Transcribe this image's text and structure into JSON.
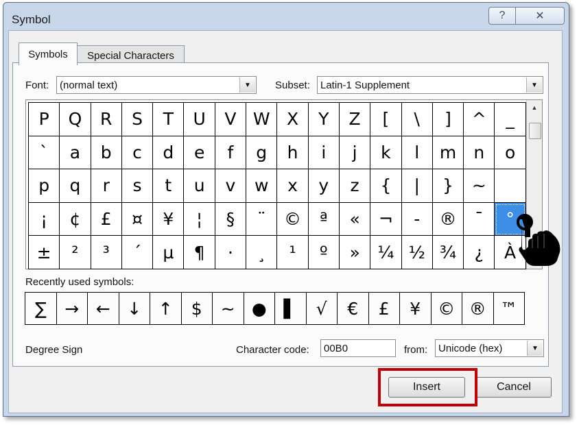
{
  "window": {
    "title": "Symbol",
    "help_glyph": "?",
    "close_glyph": "✕"
  },
  "tabs": [
    {
      "label": "Symbols",
      "active": true
    },
    {
      "label": "Special Characters",
      "active": false
    }
  ],
  "font": {
    "label": "Font:",
    "value": "(normal text)"
  },
  "subset": {
    "label": "Subset:",
    "value": "Latin-1 Supplement"
  },
  "symbols_grid": [
    [
      "P",
      "Q",
      "R",
      "S",
      "T",
      "U",
      "V",
      "W",
      "X",
      "Y",
      "Z",
      "[",
      "\\",
      "]",
      "^",
      "_"
    ],
    [
      "`",
      "a",
      "b",
      "c",
      "d",
      "e",
      "f",
      "g",
      "h",
      "i",
      "j",
      "k",
      "l",
      "m",
      "n",
      "o"
    ],
    [
      "p",
      "q",
      "r",
      "s",
      "t",
      "u",
      "v",
      "w",
      "x",
      "y",
      "z",
      "{",
      "|",
      "}",
      "~",
      ""
    ],
    [
      "¡",
      "¢",
      "£",
      "¤",
      "¥",
      "¦",
      "§",
      "¨",
      "©",
      "ª",
      "«",
      "¬",
      "-",
      "®",
      "¯",
      "°"
    ],
    [
      "±",
      "²",
      "³",
      "´",
      "µ",
      "¶",
      "·",
      "¸",
      "¹",
      "º",
      "»",
      "¼",
      "½",
      "¾",
      "¿",
      "À"
    ]
  ],
  "selected_symbol": "°",
  "recently_used": {
    "label": "Recently used symbols:",
    "symbols": [
      "∑",
      "→",
      "←",
      "↓",
      "↑",
      "$",
      "~",
      "●",
      "▌",
      "√",
      "€",
      "£",
      "¥",
      "©",
      "®",
      "™"
    ]
  },
  "character_name": "Degree Sign",
  "character_code": {
    "label": "Character code:",
    "value": "00B0"
  },
  "from": {
    "label": "from:",
    "value": "Unicode (hex)"
  },
  "buttons": {
    "insert": "Insert",
    "cancel": "Cancel"
  },
  "colors": {
    "selection": "#3d8ee5",
    "highlight_border": "#c00000",
    "dialog_frame": "#c7d6e8"
  },
  "icons": {
    "pointer": "hand-pointer-icon",
    "dropdown": "chevron-down-icon",
    "scroll_up": "scroll-up-arrow-icon"
  }
}
